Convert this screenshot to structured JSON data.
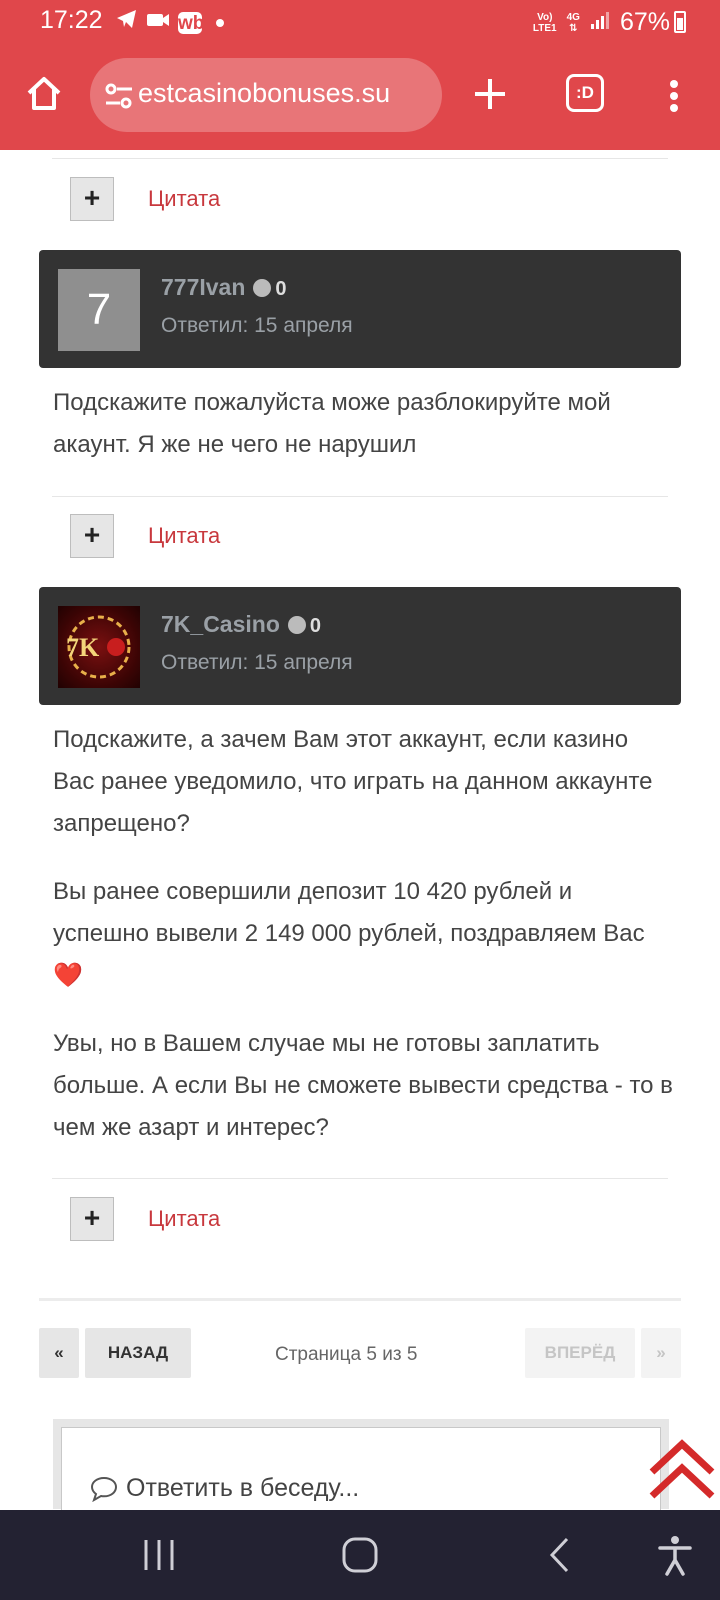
{
  "status_bar": {
    "time": "17:22",
    "wb_label": "wb",
    "net_top": "Vo)",
    "net_bottom": "LTE1",
    "net_type": "4G",
    "battery": "67%"
  },
  "browser": {
    "url": "estcasinobonuses.su",
    "tabs_label": ":D"
  },
  "posts": [
    {
      "username": "777Ivan",
      "avatar_letter": "7",
      "reputation": "0",
      "replied": "Ответил: 15 апреля",
      "paragraphs": [
        "Подскажите пожалуйста може разблокируйте мой акаунт.  Я же не чего не нарушил"
      ]
    },
    {
      "username": "7K_Casino",
      "avatar_text": "7K",
      "reputation": "0",
      "replied": "Ответил: 15 апреля",
      "paragraphs": [
        "Подскажите, а зачем Вам этот аккаунт, если казино Вас ранее уведомило, что играть на данном аккаунте запрещено?",
        "Вы ранее совершили депозит 10 420 рублей и успешно вывели 2 149 000 рублей, поздравляем Вас ❤️",
        "Увы, но в Вашем случае мы не готовы заплатить больше. А если Вы не сможете вывести средства - то в чем же азарт и интерес?"
      ]
    }
  ],
  "quote": {
    "plus": "+",
    "label": "Цитата"
  },
  "pagination": {
    "first": "«",
    "prev": "НАЗАД",
    "info": "Страница 5 из 5",
    "next": "ВПЕРЁД",
    "last": "»"
  },
  "reply": {
    "placeholder": "Ответить в беседу..."
  },
  "colors": {
    "browser_bar": "#e0474b",
    "accent_link": "#c8383d",
    "post_header": "#333333",
    "nav_bar": "#232232"
  },
  "icons": [
    "home-icon",
    "tune-icon",
    "plus-icon",
    "tabs-icon",
    "more-icon",
    "chat-icon",
    "scroll-top-icon",
    "recents-icon",
    "home-nav-icon",
    "back-icon",
    "accessibility-icon"
  ]
}
